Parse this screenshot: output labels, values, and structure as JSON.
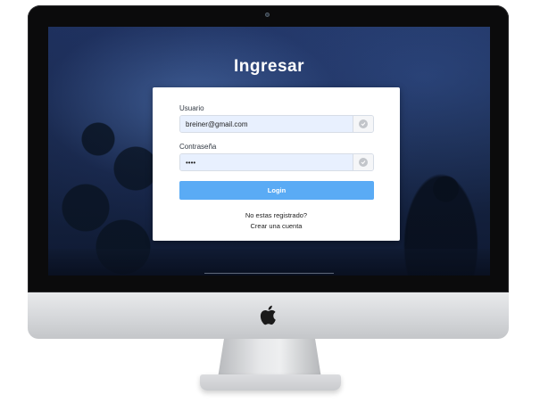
{
  "page": {
    "title": "Ingresar"
  },
  "login_form": {
    "username_label": "Usuario",
    "username_value": "breiner@gmail.com",
    "password_label": "Contraseña",
    "password_value": "••••",
    "submit_label": "Login",
    "register_prompt": "No estas registrado?",
    "create_account_link": "Crear una cuenta",
    "username_icon": "check-icon",
    "password_icon": "check-icon"
  },
  "colors": {
    "button": "#5aabf5",
    "input_background": "#e8f0fe",
    "screen_background": "#172646"
  },
  "device": {
    "logo_icon": "apple-logo-icon"
  }
}
